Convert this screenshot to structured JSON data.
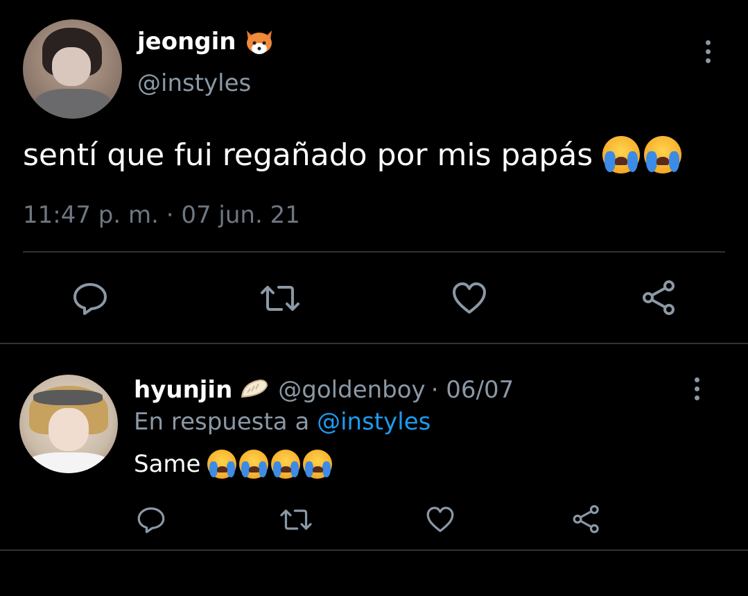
{
  "main_tweet": {
    "display_name": "jeongin",
    "name_emoji": "fox-icon",
    "handle": "@instyles",
    "text": "sentí que fui regañado por mis papás",
    "text_emojis": [
      "loudly-crying-face",
      "loudly-crying-face"
    ],
    "timestamp": "11:47 p. m. · 07 jun. 21",
    "actions": [
      "reply-icon",
      "retweet-icon",
      "like-icon",
      "share-icon"
    ]
  },
  "reply_tweet": {
    "display_name": "hyunjin",
    "name_emoji": "dumpling-icon",
    "handle": "@goldenboy",
    "date": "· 06/07",
    "reply_prefix": "En respuesta a",
    "reply_to": "@instyles",
    "text": "Same",
    "text_emojis": [
      "loudly-crying-face",
      "loudly-crying-face",
      "loudly-crying-face",
      "loudly-crying-face"
    ],
    "actions": [
      "reply-icon",
      "retweet-icon",
      "like-icon",
      "share-icon"
    ]
  },
  "colors": {
    "background": "#000000",
    "secondary_text": "#8b98a5",
    "link": "#1d9bf0",
    "divider": "#2f3336"
  }
}
